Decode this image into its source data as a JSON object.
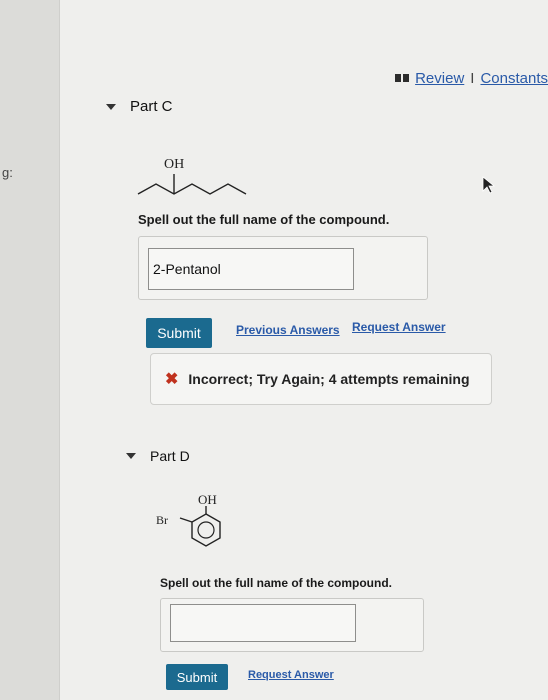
{
  "header": {
    "review_label": "Review",
    "separator": "I",
    "constants_label": "Constants"
  },
  "left_fragment": "g:",
  "part_c": {
    "title": "Part C",
    "structure_label": "OH",
    "prompt": "Spell out the full name of the compound.",
    "answer_value": "2-Pentanol",
    "submit_label": "Submit",
    "previous_answers_label": "Previous Answers",
    "request_answer_label": "Request Answer",
    "feedback": "Incorrect; Try Again; 4 attempts remaining",
    "feedback_icon": "x-icon",
    "feedback_color": "#c0321e"
  },
  "part_d": {
    "title": "Part D",
    "structure_label_oh": "OH",
    "structure_label_br": "Br",
    "prompt": "Spell out the full name of the compound.",
    "answer_value": "",
    "submit_label": "Submit",
    "request_answer_label": "Request Answer"
  },
  "colors": {
    "accent": "#1b6a8f",
    "link": "#2a5aa8",
    "error": "#c0321e"
  }
}
